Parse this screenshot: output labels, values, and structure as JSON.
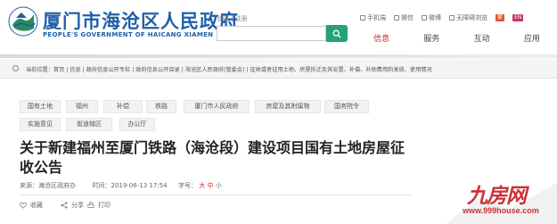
{
  "header": {
    "site_title": "厦门市海沧区人民政府",
    "site_subtitle": "PEOPLE'S GOVERNMENT OF HAICANG XIAMEN",
    "login_links": "登录 | 注册",
    "search": {
      "placeholder": ""
    },
    "top_links": [
      {
        "label": "手机端",
        "icon": "mobile-icon"
      },
      {
        "label": "微信",
        "icon": "wechat-icon"
      },
      {
        "label": "微博",
        "icon": "weibo-icon"
      },
      {
        "label": "无障碍浏览",
        "icon": "accessibility-icon"
      }
    ],
    "lang_badges": [
      {
        "label": "繁",
        "color": "#e0572a"
      },
      {
        "label": "EN",
        "color": "#c8336b"
      }
    ],
    "nav": [
      {
        "label": "信息",
        "active": true
      },
      {
        "label": "服务",
        "active": false
      },
      {
        "label": "互动",
        "active": false
      },
      {
        "label": "应用",
        "active": false
      }
    ]
  },
  "breadcrumb": {
    "text": "当前位置：首页 | 信息 | 政府信息公开专栏 | 政府信息公开目录 | 海沧区人民政府(管委会) | 征收或者征用土地、房屋拆迁及其安置、补偿、补助费用的发放、使用情况"
  },
  "tags": [
    "国有土地",
    "福州",
    "补偿",
    "铁路",
    "厦门市人民政府",
    "房屋及其附属物",
    "国务院令",
    "实施意见",
    "街道辖区",
    "办公厅"
  ],
  "article": {
    "title": "关于新建福州至厦门铁路（海沧段）建设项目国有土地房屋征收公告",
    "source_label": "来源：",
    "source": "海沧区政府办",
    "date_label": "时间：",
    "date": "2019-06-13 17:54",
    "size_label": "字号：",
    "size_big": "大",
    "size_mid": "中",
    "size_small": "小",
    "actions": [
      {
        "label": "收藏",
        "icon": "heart-icon"
      },
      {
        "label": "分享",
        "icon": "share-icon"
      },
      {
        "label": "打印",
        "icon": "print-icon"
      }
    ]
  },
  "watermark": {
    "main": "九房网",
    "url": "www.999house.com"
  },
  "colors": {
    "brand": "#1f5fa8",
    "search_button": "#25a07a",
    "active_nav": "#cc2222",
    "watermark": "#c9313a"
  }
}
